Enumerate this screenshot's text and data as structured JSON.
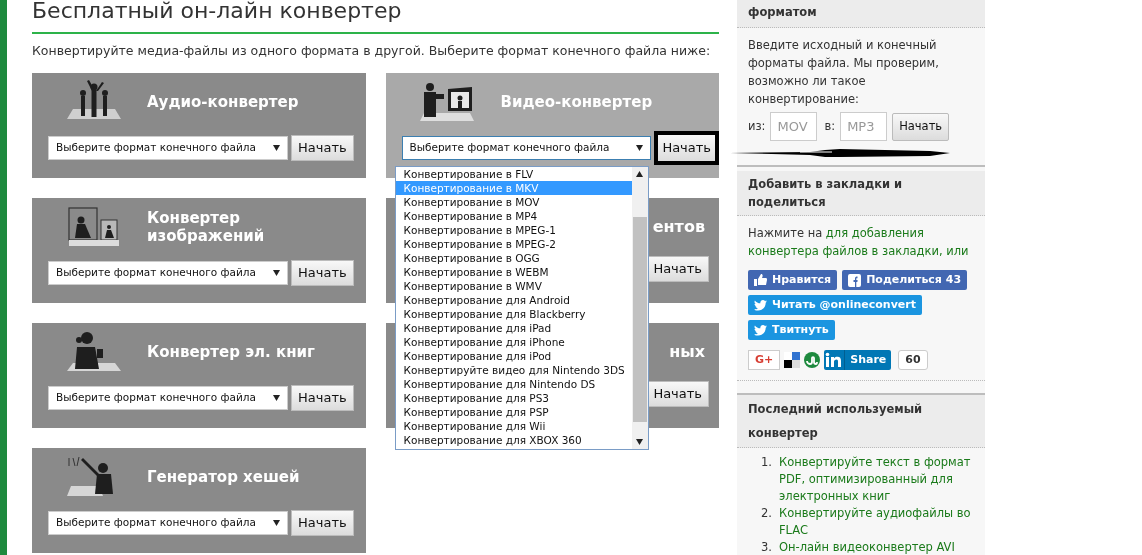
{
  "page_title": "Бесплатный он-лайн конвертер",
  "intro": "Конвертируйте медиа-файлы из одного формата в другой. Выберите формат конечного файла ниже:",
  "converters": [
    {
      "kind": "full",
      "title": "Аудио-конвертер",
      "hovered": false,
      "select": "Выберите формат конечного файла",
      "button": "Начать",
      "button_outlined": false
    },
    {
      "kind": "full",
      "title": "Видео-конвертер",
      "hovered": true,
      "select": "Выберите формат конечного файла",
      "button": "Начать",
      "button_outlined": true,
      "dropdown": {
        "options": [
          {
            "label": "Конвертирование в FLV",
            "selected": false
          },
          {
            "label": "Конвертирование в MKV",
            "selected": true
          },
          {
            "label": "Конвертирование в MOV",
            "selected": false
          },
          {
            "label": "Конвертирование в MP4",
            "selected": false
          },
          {
            "label": "Конвертирование в MPEG-1",
            "selected": false
          },
          {
            "label": "Конвертирование в MPEG-2",
            "selected": false
          },
          {
            "label": "Конвертирование в OGG",
            "selected": false
          },
          {
            "label": "Конвертирование в WEBM",
            "selected": false
          },
          {
            "label": "Конвертирование в WMV",
            "selected": false
          },
          {
            "label": "Конвертирование для Android",
            "selected": false
          },
          {
            "label": "Конвертирование для Blackberry",
            "selected": false
          },
          {
            "label": "Конвертирование для iPad",
            "selected": false
          },
          {
            "label": "Конвертирование для iPhone",
            "selected": false
          },
          {
            "label": "Конвертирование для iPod",
            "selected": false
          },
          {
            "label": "Конвертируйте видео для Nintendo 3DS",
            "selected": false
          },
          {
            "label": "Конвертирование для Nintendo DS",
            "selected": false
          },
          {
            "label": "Конвертирование для PS3",
            "selected": false
          },
          {
            "label": "Конвертирование для PSP",
            "selected": false
          },
          {
            "label": "Конвертирование для Wii",
            "selected": false
          },
          {
            "label": "Конвертирование для XBOX 360",
            "selected": false
          }
        ]
      }
    },
    {
      "kind": "full",
      "title": "Конвертер изображений",
      "hovered": false,
      "select": "Выберите формат конечного файла",
      "button": "Начать",
      "button_outlined": false
    },
    {
      "kind": "covered",
      "title": "ентов",
      "hovered": false,
      "button": "Начать",
      "button_outlined": false
    },
    {
      "kind": "full",
      "title": "Конвертер эл. книг",
      "hovered": false,
      "select": "Выберите формат конечного файла",
      "button": "Начать",
      "button_outlined": false
    },
    {
      "kind": "covered",
      "title": "ных",
      "hovered": false,
      "button": "Начать",
      "button_outlined": false
    },
    {
      "kind": "full",
      "title": "Генератор хешей",
      "hovered": false,
      "select": "Выберите формат конечного файла",
      "button": "Начать",
      "button_outlined": false
    }
  ],
  "sidebar": {
    "format_check": {
      "title": "форматом",
      "text": "Введите исходный и конечный форматы файла. Мы проверим, возможно ли такое конвертирование:",
      "from_label": "из:",
      "from_placeholder": "MOV",
      "to_label": "в:",
      "to_placeholder": "MP3",
      "button": "Начать"
    },
    "share": {
      "title": "Добавить в закладки и поделиться",
      "text": "Нажмите на",
      "links": [
        "для добавления",
        "конвертера файлов в закладки, или"
      ],
      "buttons": [
        {
          "kind": "like",
          "label": "Нравится"
        },
        {
          "kind": "facebook",
          "label": "Поделиться 43"
        },
        {
          "kind": "twitter",
          "label": "Читать @onlineconvert"
        },
        {
          "kind": "twitter",
          "label": "Твитнуть"
        }
      ],
      "gplus": "G+",
      "linkedin": "Share",
      "linkedin_count": "60"
    },
    "recent": {
      "title": "Последний используемый конвертер",
      "items": [
        {
          "number": "1.",
          "text": "Конвертируйте текст в формат PDF, оптимизированный для электронных книг"
        },
        {
          "number": "2.",
          "text": "Конвертируйте аудиофайлы во FLAC"
        },
        {
          "number": "3.",
          "text": "Он-лайн видеоконвертер AVI"
        }
      ]
    }
  }
}
